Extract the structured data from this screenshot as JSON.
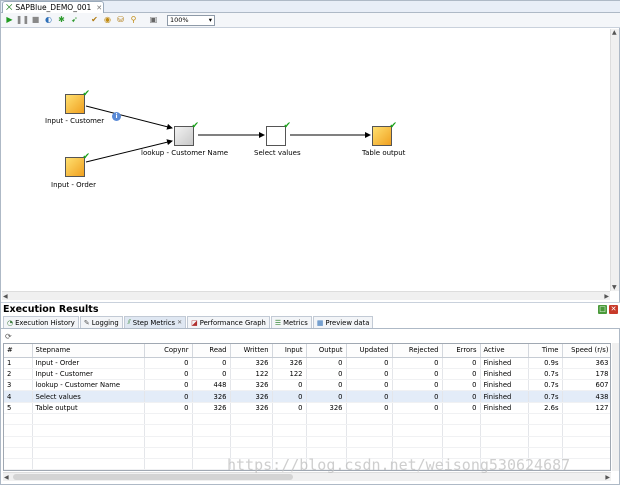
{
  "editor": {
    "tab_title": "SAPBlue_DEMO_001",
    "close_glyph": "✕",
    "zoom": "100%"
  },
  "toolbar_icons": [
    "run-icon",
    "pause-icon",
    "stop-icon",
    "preview-icon",
    "debug-icon",
    "replay-icon",
    "verify-icon",
    "impact-icon",
    "sql-icon",
    "explore-db-icon",
    "show-results-icon"
  ],
  "canvas": {
    "steps": [
      {
        "id": "input-customer",
        "label": "Input - Customer"
      },
      {
        "id": "input-order",
        "label": "Input - Order"
      },
      {
        "id": "lookup-customer-name",
        "label": "lookup - Customer Name"
      },
      {
        "id": "select-values",
        "label": "Select values"
      },
      {
        "id": "table-output",
        "label": "Table output"
      }
    ],
    "info_badge": "i"
  },
  "execution_results": {
    "title": "Execution Results",
    "tabs": [
      {
        "label": "Execution History",
        "icon": "history-icon"
      },
      {
        "label": "Logging",
        "icon": "logging-icon"
      },
      {
        "label": "Step Metrics",
        "icon": "step-metrics-icon",
        "active": true
      },
      {
        "label": "Performance Graph",
        "icon": "performance-graph-icon"
      },
      {
        "label": "Metrics",
        "icon": "metrics-icon"
      },
      {
        "label": "Preview data",
        "icon": "preview-data-icon"
      }
    ],
    "columns": [
      "#",
      "Stepname",
      "Copynr",
      "Read",
      "Written",
      "Input",
      "Output",
      "Updated",
      "Rejected",
      "Errors",
      "Active",
      "Time",
      "Speed (r/s)"
    ],
    "rows": [
      [
        "1",
        "Input - Order",
        "0",
        "0",
        "326",
        "326",
        "0",
        "0",
        "0",
        "0",
        "Finished",
        "0.9s",
        "363"
      ],
      [
        "2",
        "Input - Customer",
        "0",
        "0",
        "122",
        "122",
        "0",
        "0",
        "0",
        "0",
        "Finished",
        "0.7s",
        "178"
      ],
      [
        "3",
        "lookup - Customer Name",
        "0",
        "448",
        "326",
        "0",
        "0",
        "0",
        "0",
        "0",
        "Finished",
        "0.7s",
        "607"
      ],
      [
        "4",
        "Select values",
        "0",
        "326",
        "326",
        "0",
        "0",
        "0",
        "0",
        "0",
        "Finished",
        "0.7s",
        "438"
      ],
      [
        "5",
        "Table output",
        "0",
        "326",
        "326",
        "0",
        "326",
        "0",
        "0",
        "0",
        "Finished",
        "2.6s",
        "127"
      ]
    ]
  },
  "watermark": "https://blog.csdn.net/weisong530624687"
}
